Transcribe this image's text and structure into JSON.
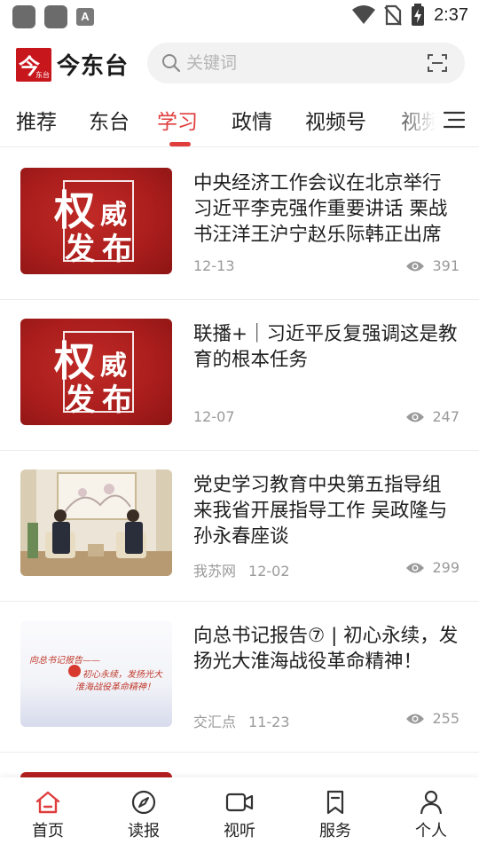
{
  "status_bar": {
    "time": "2:37",
    "notification_icon_letter": "A"
  },
  "header": {
    "logo_big_char": "今",
    "logo_small_text": "东台",
    "app_name": "今东台",
    "search_placeholder": "关键词"
  },
  "tabs": [
    {
      "label": "推荐",
      "active": false
    },
    {
      "label": "东台",
      "active": false
    },
    {
      "label": "学习",
      "active": true
    },
    {
      "label": "政情",
      "active": false
    },
    {
      "label": "视频号",
      "active": false
    },
    {
      "label": "视频",
      "active": false
    }
  ],
  "news": [
    {
      "title": "中央经济工作会议在北京举行 习近平李克强作重要讲话 栗战书汪洋王沪宁赵乐际韩正出席会议",
      "source": "",
      "date": "12-13",
      "views": "391",
      "thumb_type": "authority",
      "thumb_chars": [
        "权",
        "威",
        "发",
        "布"
      ]
    },
    {
      "title": "联播+｜习近平反复强调这是教育的根本任务",
      "source": "",
      "date": "12-07",
      "views": "247",
      "thumb_type": "authority",
      "thumb_chars": [
        "权",
        "威",
        "发",
        "布"
      ]
    },
    {
      "title": "党史学习教育中央第五指导组来我省开展指导工作 吴政隆与孙永春座谈",
      "source": "我苏网",
      "date": "12-02",
      "views": "299",
      "thumb_type": "photo"
    },
    {
      "title": "向总书记报告⑦ | 初心永续，发扬光大淮海战役革命精神！",
      "source": "交汇点",
      "date": "11-23",
      "views": "255",
      "thumb_type": "calligraphy",
      "thumb_lines": [
        "向总书记报告——",
        "初心永续，发扬光大",
        "淮海战役革命精神！"
      ]
    }
  ],
  "bottom_nav": [
    {
      "label": "首页",
      "icon": "home-icon",
      "active": true
    },
    {
      "label": "读报",
      "icon": "compass-icon",
      "active": false
    },
    {
      "label": "视听",
      "icon": "video-camera-icon",
      "active": false
    },
    {
      "label": "服务",
      "icon": "bookmark-icon",
      "active": false
    },
    {
      "label": "个人",
      "icon": "person-icon",
      "active": false
    }
  ],
  "colors": {
    "accent": "#e03d3d",
    "brand_red": "#c8161d",
    "meta_gray": "#9a9a9a"
  }
}
